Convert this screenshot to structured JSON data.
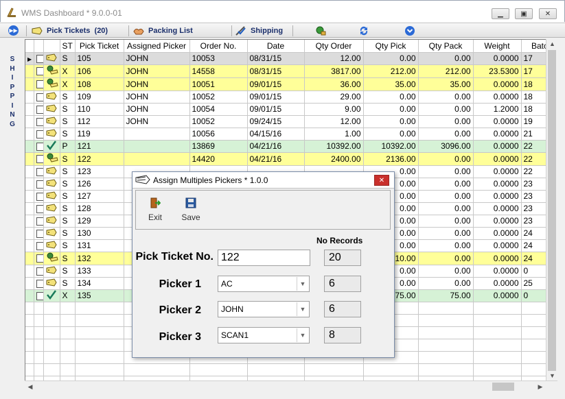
{
  "window": {
    "title": "WMS Dashboard * 9.0.0-01"
  },
  "toolbar": {
    "pick_tickets_label": "Pick Tickets",
    "pick_tickets_count": "(20)",
    "packing_list_label": "Packing List",
    "shipping_label": "Shipping"
  },
  "side_tab": {
    "letters": [
      "S",
      "H",
      "I",
      "P",
      "P",
      "I",
      "N",
      "G"
    ]
  },
  "grid": {
    "columns": [
      "ST",
      "Pick Ticket",
      "Assigned Picker",
      "Order No.",
      "Date",
      "Qty Order",
      "Qty Pick",
      "Qty Pack",
      "Weight",
      "Batc"
    ],
    "rows": [
      {
        "style": "grey",
        "icon": "ticket",
        "st": "S",
        "ticket": "105",
        "picker": "JOHN",
        "order": "10053",
        "date": "08/31/15",
        "qty_order": "12.00",
        "qty_pick": "0.00",
        "qty_pack": "0.00",
        "weight": "0.0000",
        "batch": "17"
      },
      {
        "style": "yellow",
        "icon": "partial",
        "st": "X",
        "ticket": "106",
        "picker": "JOHN",
        "order": "14558",
        "date": "08/31/15",
        "qty_order": "3817.00",
        "qty_pick": "212.00",
        "qty_pack": "212.00",
        "weight": "23.5300",
        "batch": "17"
      },
      {
        "style": "yellow",
        "icon": "partial",
        "st": "X",
        "ticket": "108",
        "picker": "JOHN",
        "order": "10051",
        "date": "09/01/15",
        "qty_order": "36.00",
        "qty_pick": "35.00",
        "qty_pack": "35.00",
        "weight": "0.0000",
        "batch": "18"
      },
      {
        "style": "white",
        "icon": "ticket",
        "st": "S",
        "ticket": "109",
        "picker": "JOHN",
        "order": "10052",
        "date": "09/01/15",
        "qty_order": "29.00",
        "qty_pick": "0.00",
        "qty_pack": "0.00",
        "weight": "0.0000",
        "batch": "18"
      },
      {
        "style": "white",
        "icon": "ticket",
        "st": "S",
        "ticket": "110",
        "picker": "JOHN",
        "order": "10054",
        "date": "09/01/15",
        "qty_order": "9.00",
        "qty_pick": "0.00",
        "qty_pack": "0.00",
        "weight": "1.2000",
        "batch": "18"
      },
      {
        "style": "white",
        "icon": "ticket",
        "st": "S",
        "ticket": "112",
        "picker": "JOHN",
        "order": "10052",
        "date": "09/24/15",
        "qty_order": "12.00",
        "qty_pick": "0.00",
        "qty_pack": "0.00",
        "weight": "0.0000",
        "batch": "19"
      },
      {
        "style": "white",
        "icon": "ticket",
        "st": "S",
        "ticket": "119",
        "picker": "",
        "order": "10056",
        "date": "04/15/16",
        "qty_order": "1.00",
        "qty_pick": "0.00",
        "qty_pack": "0.00",
        "weight": "0.0000",
        "batch": "21"
      },
      {
        "style": "green",
        "icon": "check",
        "st": "P",
        "ticket": "121",
        "picker": "",
        "order": "13869",
        "date": "04/21/16",
        "qty_order": "10392.00",
        "qty_pick": "10392.00",
        "qty_pack": "3096.00",
        "weight": "0.0000",
        "batch": "22"
      },
      {
        "style": "yellow",
        "icon": "partial",
        "st": "S",
        "ticket": "122",
        "picker": "",
        "order": "14420",
        "date": "04/21/16",
        "qty_order": "2400.00",
        "qty_pick": "2136.00",
        "qty_pack": "0.00",
        "weight": "0.0000",
        "batch": "22"
      },
      {
        "style": "white",
        "icon": "ticket",
        "st": "S",
        "ticket": "123",
        "picker": "",
        "order": "",
        "date": "",
        "qty_order": "",
        "qty_pick": "0.00",
        "qty_pack": "0.00",
        "weight": "0.0000",
        "batch": "22"
      },
      {
        "style": "white",
        "icon": "ticket",
        "st": "S",
        "ticket": "126",
        "picker": "",
        "order": "",
        "date": "",
        "qty_order": "",
        "qty_pick": "0.00",
        "qty_pack": "0.00",
        "weight": "0.0000",
        "batch": "23"
      },
      {
        "style": "white",
        "icon": "ticket",
        "st": "S",
        "ticket": "127",
        "picker": "",
        "order": "",
        "date": "",
        "qty_order": "",
        "qty_pick": "0.00",
        "qty_pack": "0.00",
        "weight": "0.0000",
        "batch": "23"
      },
      {
        "style": "white",
        "icon": "ticket",
        "st": "S",
        "ticket": "128",
        "picker": "",
        "order": "",
        "date": "",
        "qty_order": "",
        "qty_pick": "0.00",
        "qty_pack": "0.00",
        "weight": "0.0000",
        "batch": "23"
      },
      {
        "style": "white",
        "icon": "ticket",
        "st": "S",
        "ticket": "129",
        "picker": "",
        "order": "",
        "date": "",
        "qty_order": "",
        "qty_pick": "0.00",
        "qty_pack": "0.00",
        "weight": "0.0000",
        "batch": "23"
      },
      {
        "style": "white",
        "icon": "ticket",
        "st": "S",
        "ticket": "130",
        "picker": "",
        "order": "",
        "date": "",
        "qty_order": "",
        "qty_pick": "0.00",
        "qty_pack": "0.00",
        "weight": "0.0000",
        "batch": "24"
      },
      {
        "style": "white",
        "icon": "ticket",
        "st": "S",
        "ticket": "131",
        "picker": "",
        "order": "",
        "date": "",
        "qty_order": "",
        "qty_pick": "0.00",
        "qty_pack": "0.00",
        "weight": "0.0000",
        "batch": "24"
      },
      {
        "style": "yellow",
        "icon": "partial",
        "st": "S",
        "ticket": "132",
        "picker": "",
        "order": "",
        "date": "",
        "qty_order": "",
        "qty_pick": "10.00",
        "qty_pack": "0.00",
        "weight": "0.0000",
        "batch": "24"
      },
      {
        "style": "white",
        "icon": "ticket",
        "st": "S",
        "ticket": "133",
        "picker": "",
        "order": "",
        "date": "",
        "qty_order": "",
        "qty_pick": "0.00",
        "qty_pack": "0.00",
        "weight": "0.0000",
        "batch": "0"
      },
      {
        "style": "white",
        "icon": "ticket",
        "st": "S",
        "ticket": "134",
        "picker": "",
        "order": "",
        "date": "",
        "qty_order": "",
        "qty_pick": "0.00",
        "qty_pack": "0.00",
        "weight": "0.0000",
        "batch": "25"
      },
      {
        "style": "green",
        "icon": "check",
        "st": "X",
        "ticket": "135",
        "picker": "",
        "order": "",
        "date": "",
        "qty_order": "",
        "qty_pick": "75.00",
        "qty_pack": "75.00",
        "weight": "0.0000",
        "batch": "0"
      }
    ],
    "empty_rows": 7
  },
  "dialog": {
    "title": "Assign Multiples Pickers * 1.0.0",
    "exit_label": "Exit",
    "save_label": "Save",
    "no_records_label": "No Records",
    "pick_ticket_label": "Pick Ticket No.",
    "pick_ticket_value": "122",
    "pick_ticket_records": "20",
    "picker1_label": "Picker 1",
    "picker1_value": "AC",
    "picker1_records": "6",
    "picker2_label": "Picker 2",
    "picker2_value": "JOHN",
    "picker2_records": "6",
    "picker3_label": "Picker 3",
    "picker3_value": "SCAN1",
    "picker3_records": "8"
  },
  "colors": {
    "row_yellow": "#ffff99",
    "row_green": "#d6f2d6",
    "row_grey": "#dcdcdc",
    "close_red": "#c9302c"
  }
}
